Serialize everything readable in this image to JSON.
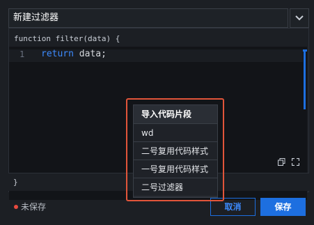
{
  "dialog": {
    "title": "新建过滤器",
    "toggle_icon": "chevron-down-icon"
  },
  "editor": {
    "func_header": "function filter(data) {",
    "line_number": "1",
    "code_keyword": "return",
    "code_rest": " data;",
    "func_footer": "}",
    "copy_icon": "copy-icon",
    "expand_icon": "expand-icon"
  },
  "footer": {
    "status": "未保存",
    "cancel_label": "取消",
    "save_label": "保存"
  },
  "dropdown": {
    "header": "导入代码片段",
    "items": [
      "wd",
      "二号复用代码样式",
      "一号复用代码样式",
      "二号过滤器"
    ]
  },
  "colors": {
    "accent": "#1d6fe0",
    "highlight": "#e2553a",
    "unsaved_dot": "#e84a3f",
    "background": "#1c1f24"
  }
}
